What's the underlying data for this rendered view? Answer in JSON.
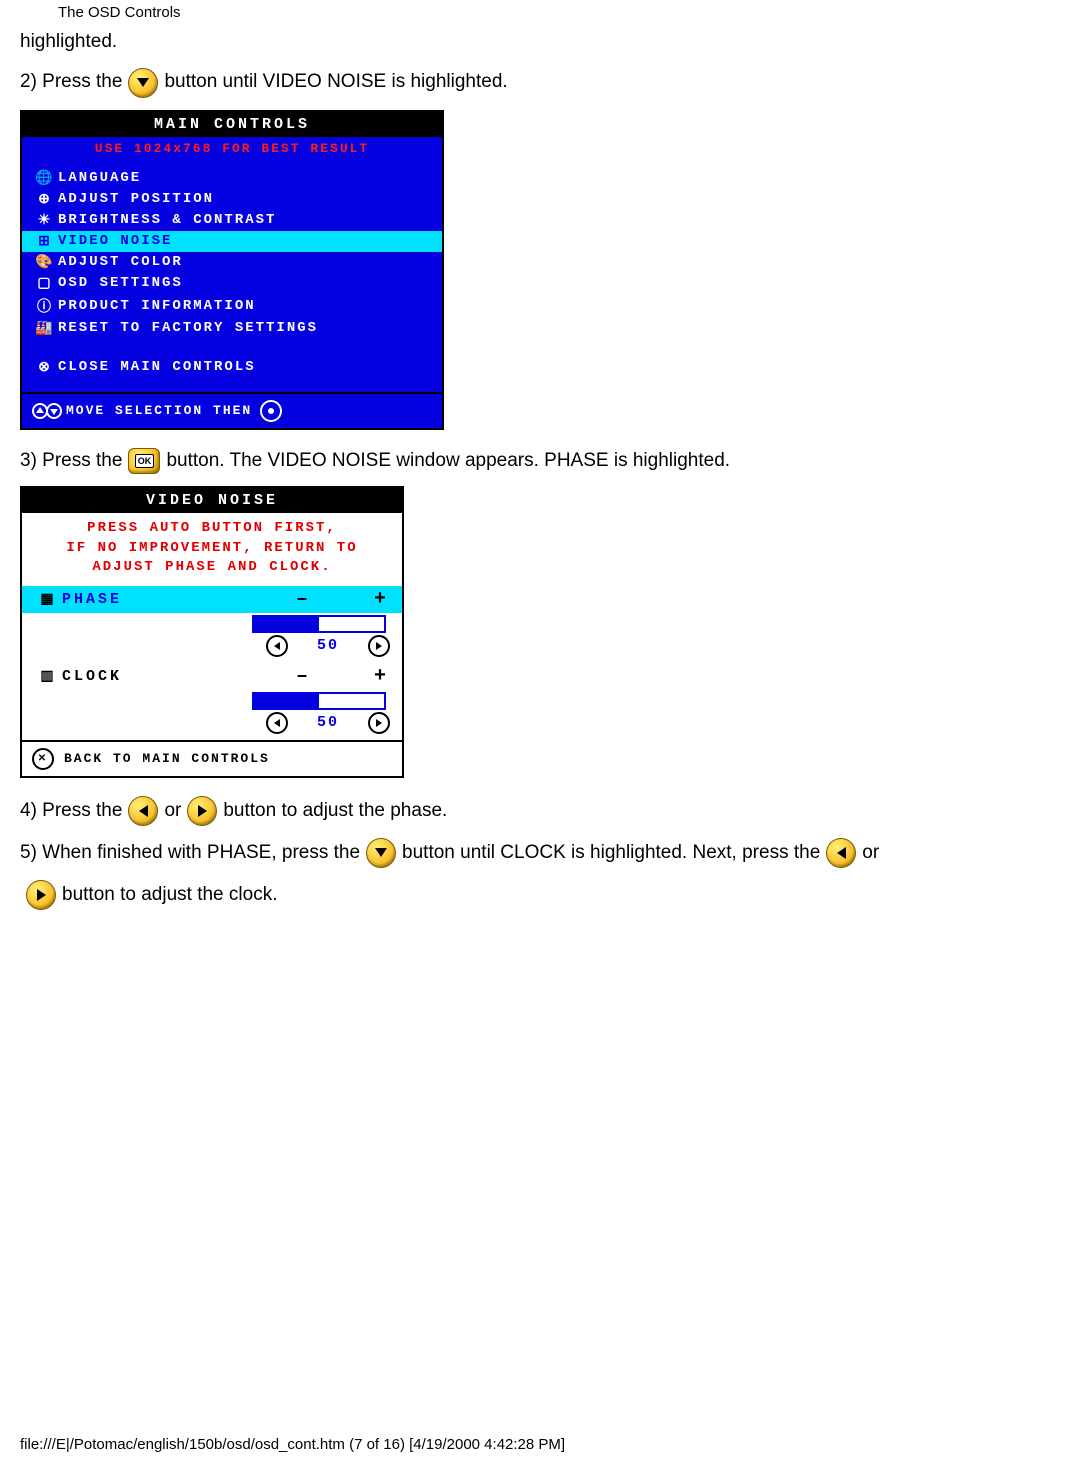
{
  "header": "The OSD Controls",
  "frag1": "highlighted.",
  "step2a": "2) Press the",
  "step2b": "button until VIDEO NOISE is highlighted.",
  "osd1": {
    "title": "MAIN CONTROLS",
    "subtitle": "USE 1024x768 FOR BEST RESULT",
    "items": [
      {
        "icon": "🌐",
        "label": "LANGUAGE"
      },
      {
        "icon": "⊕",
        "label": "ADJUST POSITION"
      },
      {
        "icon": "☀",
        "label": "BRIGHTNESS & CONTRAST"
      },
      {
        "icon": "⊞",
        "label": "VIDEO NOISE",
        "selected": true
      },
      {
        "icon": "🎨",
        "label": "ADJUST COLOR"
      },
      {
        "icon": "▢",
        "label": "OSD SETTINGS"
      },
      {
        "icon": "ⓘ",
        "label": "PRODUCT INFORMATION"
      },
      {
        "icon": "🏭",
        "label": "RESET TO FACTORY SETTINGS"
      }
    ],
    "close": {
      "icon": "⊗",
      "label": "CLOSE MAIN CONTROLS"
    },
    "footer": "MOVE SELECTION THEN"
  },
  "step3a": "3) Press the",
  "step3b": "button. The VIDEO NOISE window appears. PHASE is highlighted.",
  "vn": {
    "title": "VIDEO NOISE",
    "msg1": "PRESS AUTO BUTTON FIRST,",
    "msg2": "IF NO IMPROVEMENT, RETURN TO",
    "msg3": "ADJUST PHASE AND CLOCK.",
    "phase": {
      "label": "PHASE",
      "minus": "–",
      "plus": "+",
      "value": "50",
      "fillpct": 50
    },
    "clock": {
      "label": "CLOCK",
      "minus": "–",
      "plus": "+",
      "value": "50",
      "fillpct": 50
    },
    "foot": "BACK TO MAIN CONTROLS"
  },
  "step4a": "4) Press the",
  "step4or": "or",
  "step4b": "button to adjust the phase.",
  "step5a": "5) When finished with PHASE, press the",
  "step5b": "button until CLOCK is highlighted. Next, press the",
  "step5or": "or",
  "step5c": "button to adjust the clock.",
  "footer": "file:///E|/Potomac/english/150b/osd/osd_cont.htm (7 of 16) [4/19/2000 4:42:28 PM]"
}
